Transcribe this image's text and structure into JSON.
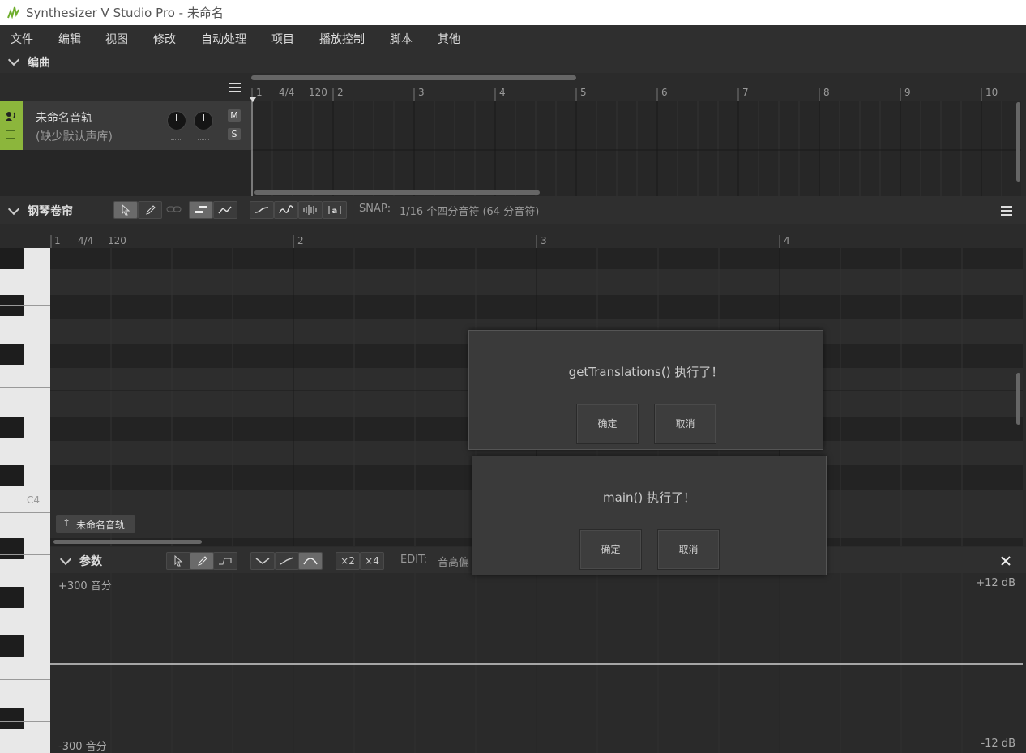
{
  "window": {
    "title": "Synthesizer V Studio Pro - 未命名"
  },
  "menu": [
    "文件",
    "编辑",
    "视图",
    "修改",
    "自动处理",
    "项目",
    "播放控制",
    "脚本",
    "其他"
  ],
  "arrangement": {
    "section_title": "编曲",
    "ruler": {
      "time_sig": "4/4",
      "tempo": "120",
      "measures": [
        "1",
        "2",
        "3",
        "4",
        "5",
        "6",
        "7",
        "8",
        "9",
        "10"
      ]
    },
    "track": {
      "name": "未命名音轨",
      "voice": "(缺少默认声库)",
      "mute": "M",
      "solo": "S"
    }
  },
  "piano_roll": {
    "section_title": "钢琴卷帘",
    "snap_label": "SNAP:",
    "snap_value": "1/16 个四分音符 (64 分音符)",
    "ruler": {
      "time_sig": "4/4",
      "tempo": "120",
      "measures": [
        "1",
        "2",
        "3",
        "4"
      ]
    },
    "key_label": "C4",
    "track_chip": "未命名音轨"
  },
  "params": {
    "section_title": "参数",
    "mult2": "×2",
    "mult4": "×4",
    "edit_label": "EDIT:",
    "edit_value": "音高偏",
    "top_left": "+300 音分",
    "bottom_left": "-300 音分",
    "top_right": "+12 dB",
    "bottom_right": "-12 dB"
  },
  "dialogs": [
    {
      "message": "getTranslations() 执行了！",
      "ok": "确定",
      "cancel": "取消"
    },
    {
      "message": "main() 执行了！",
      "ok": "确定",
      "cancel": "取消"
    }
  ],
  "colors": {
    "track_accent": "#8cb63c"
  }
}
